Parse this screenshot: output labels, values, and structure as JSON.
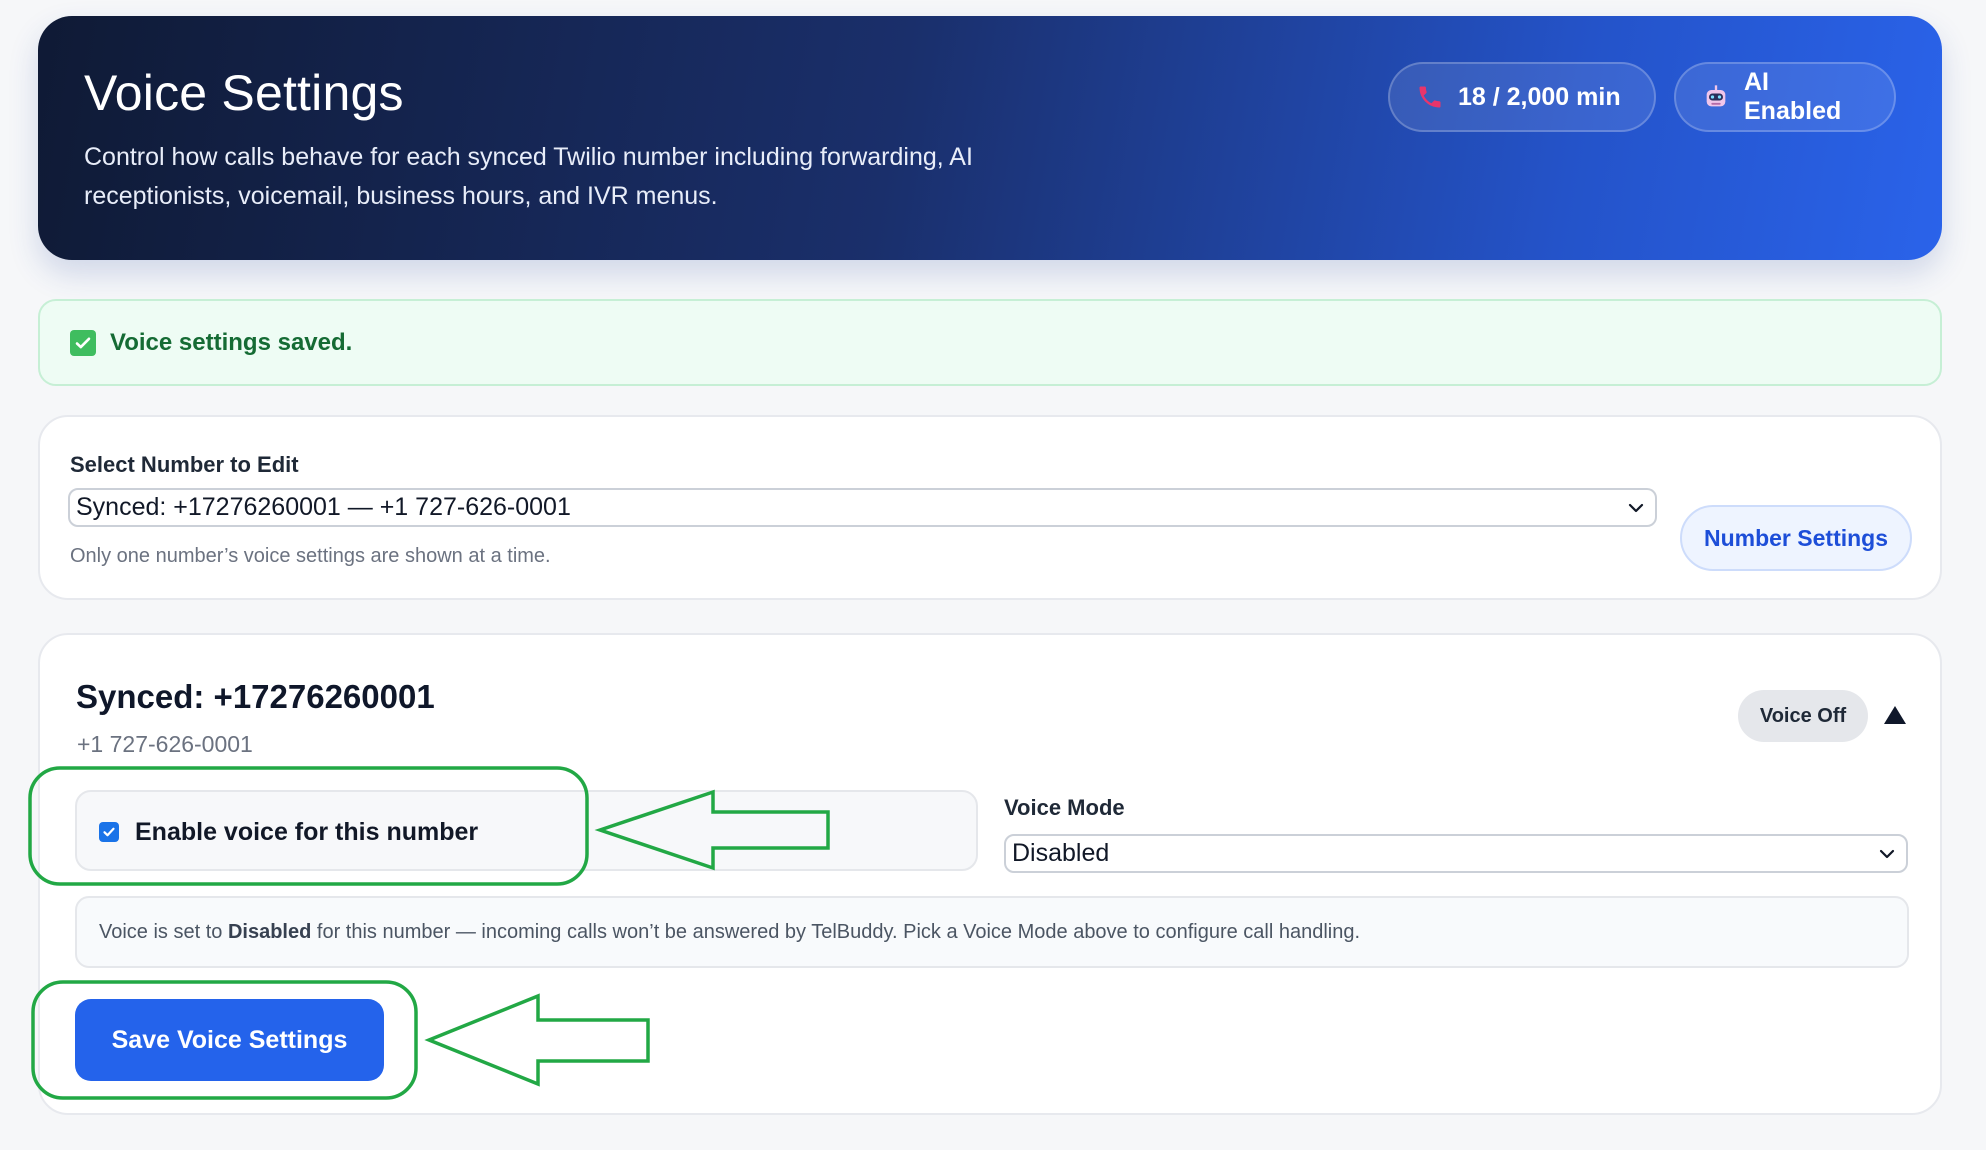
{
  "header": {
    "title": "Voice Settings",
    "description": "Control how calls behave for each synced Twilio number including forwarding, AI receptionists, voicemail, business hours, and IVR menus.",
    "minutes_pill": {
      "icon": "phone-icon",
      "label": "18 / 2,000 min"
    },
    "ai_pill": {
      "icon": "robot-icon",
      "label": "AI Enabled"
    }
  },
  "alert": {
    "icon": "check-box-icon",
    "message": "Voice settings saved."
  },
  "number_select": {
    "label": "Select Number to Edit",
    "selected": "Synced: +17276260001 — +1 727-626-0001",
    "helper": "Only one number’s voice settings are shown at a time.",
    "settings_button": "Number Settings"
  },
  "number_card": {
    "title": "Synced: +17276260001",
    "subtitle": "+1 727-626-0001",
    "status_badge": "Voice Off",
    "enable_voice": {
      "label": "Enable voice for this number",
      "checked": true
    },
    "voice_mode": {
      "label": "Voice Mode",
      "selected": "Disabled"
    },
    "info": {
      "prefix": "Voice is set to ",
      "mode": "Disabled",
      "suffix": " for this number — incoming calls won’t be answered by TelBuddy. Pick a Voice Mode above to configure call handling."
    },
    "save_button": "Save Voice Settings"
  },
  "colors": {
    "accent": "#2463eb",
    "success_bg": "#eefcf4",
    "success_text": "#156b34",
    "annotation_green": "#22a845"
  }
}
